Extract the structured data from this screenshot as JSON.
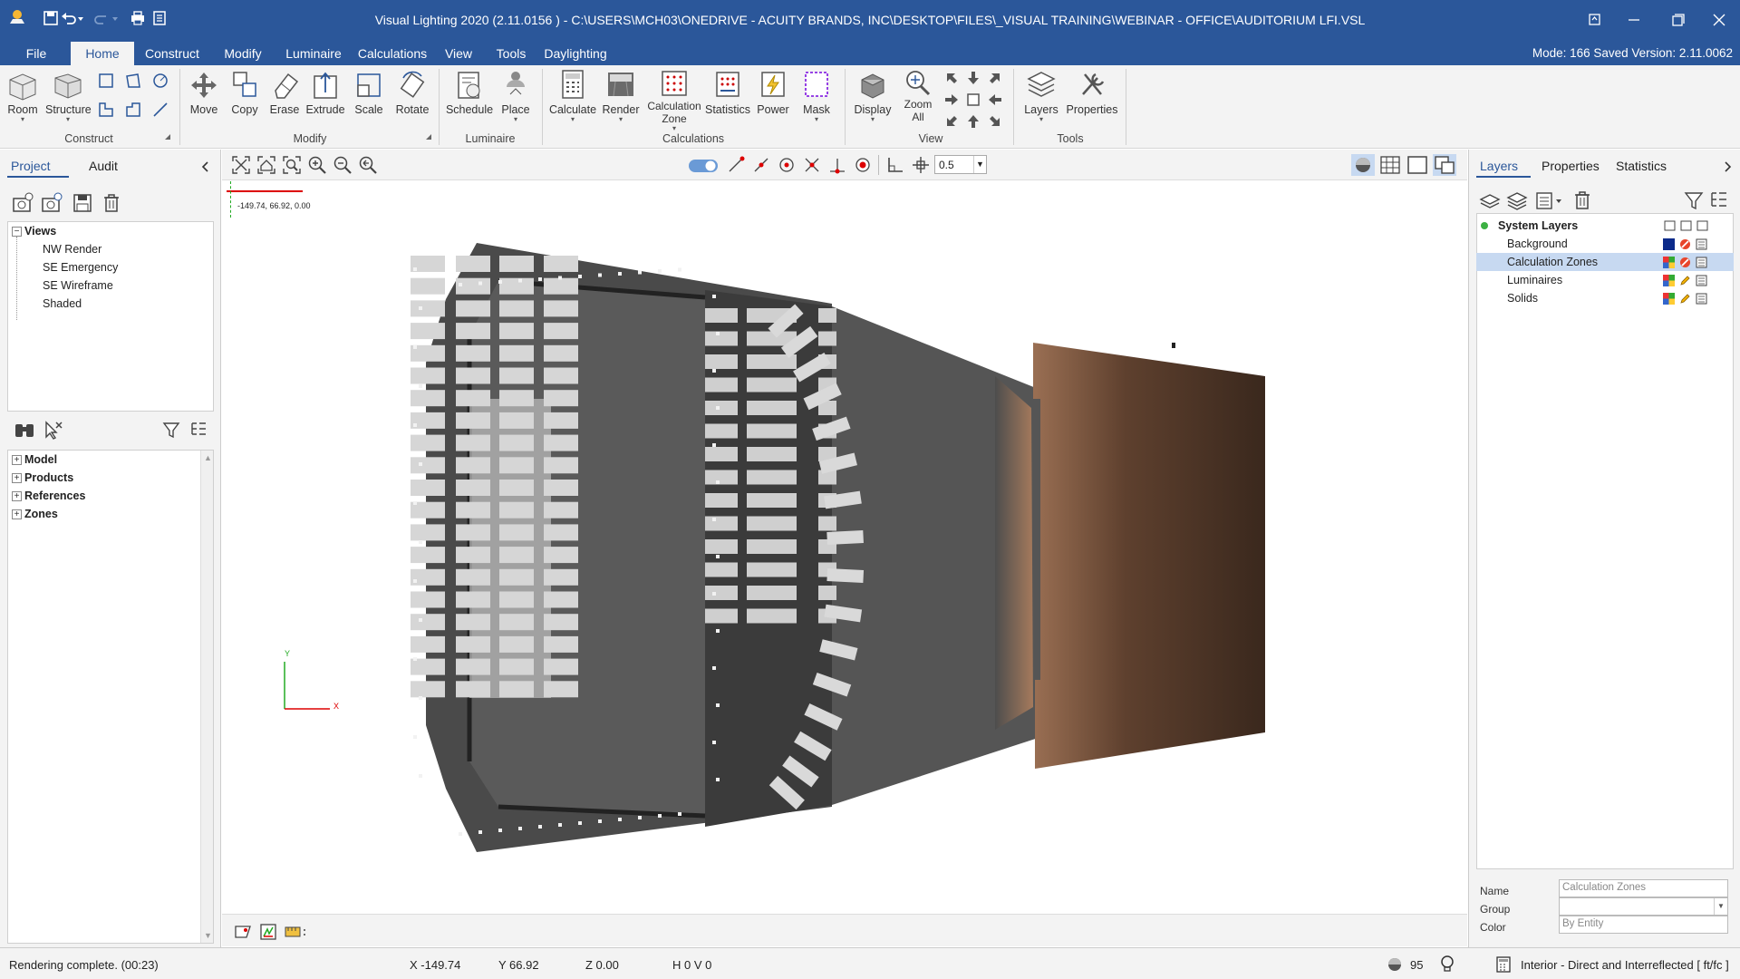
{
  "window": {
    "title": "Visual Lighting 2020 (2.11.0156 ) - C:\\USERS\\MCH03\\ONEDRIVE - ACUITY BRANDS, INC\\DESKTOP\\FILES\\_VISUAL TRAINING\\WEBINAR - OFFICE\\AUDITORIUM LFI.VSL"
  },
  "ribbon_tabs": [
    "File",
    "Home",
    "Construct",
    "Modify",
    "Luminaire",
    "Calculations",
    "View",
    "Tools",
    "Daylighting"
  ],
  "mode_info": "Mode: 166   Saved Version: 2.11.0062",
  "ribbon": {
    "construct": {
      "room": "Room",
      "structure": "Structure",
      "group": "Construct"
    },
    "modify": {
      "move": "Move",
      "copy": "Copy",
      "erase": "Erase",
      "extrude": "Extrude",
      "scale": "Scale",
      "rotate": "Rotate",
      "group": "Modify"
    },
    "luminaire": {
      "schedule": "Schedule",
      "place": "Place",
      "group": "Luminaire"
    },
    "calculations": {
      "calculate": "Calculate",
      "render": "Render",
      "calc_zone_1": "Calculation",
      "calc_zone_2": "Zone",
      "statistics": "Statistics",
      "power": "Power",
      "mask": "Mask",
      "group": "Calculations"
    },
    "view": {
      "display": "Display",
      "zoom_all_1": "Zoom",
      "zoom_all_2": "All",
      "group": "View"
    },
    "tools": {
      "layers": "Layers",
      "properties": "Properties",
      "group": "Tools"
    }
  },
  "left_panel": {
    "tabs": [
      "Project",
      "Audit"
    ],
    "views_header": "Views",
    "views": [
      "NW Render",
      "SE Emergency",
      "SE Wireframe",
      "Shaded"
    ],
    "project_tree": [
      "Model",
      "Products",
      "References",
      "Zones"
    ]
  },
  "viewbar": {
    "snap_value": "0.5"
  },
  "viewport": {
    "coord_readout": "-149.74, 66.92, 0.00",
    "axis_y": "Y",
    "axis_x": "X"
  },
  "right_panel": {
    "tabs": [
      "Layers",
      "Properties",
      "Statistics"
    ],
    "system_layers": "System Layers",
    "layers": [
      {
        "name": "Background",
        "color": "#0b2a8a",
        "selected": false
      },
      {
        "name": "Calculation Zones",
        "color": "multi",
        "selected": true
      },
      {
        "name": "Luminaires",
        "color": "multi",
        "selected": false
      },
      {
        "name": "Solids",
        "color": "multi",
        "selected": false
      }
    ],
    "props": {
      "name_label": "Name",
      "name_value": "Calculation Zones",
      "group_label": "Group",
      "group_value": "",
      "color_label": "Color",
      "color_value": "By Entity"
    }
  },
  "status_bar": {
    "message": "Rendering complete. (00:23)",
    "x": "X  -149.74",
    "y": "Y  66.92",
    "z": "Z  0.00",
    "hv": "H 0  V 0",
    "count": "95",
    "calc_mode": "Interior - Direct and Interreflected [ ft/fc ]"
  },
  "colors": {
    "title_bar": "#2b579a",
    "selection": "#c7d9f1",
    "model_floor": "#5a5a5a",
    "stage": "#3f2a1e"
  }
}
